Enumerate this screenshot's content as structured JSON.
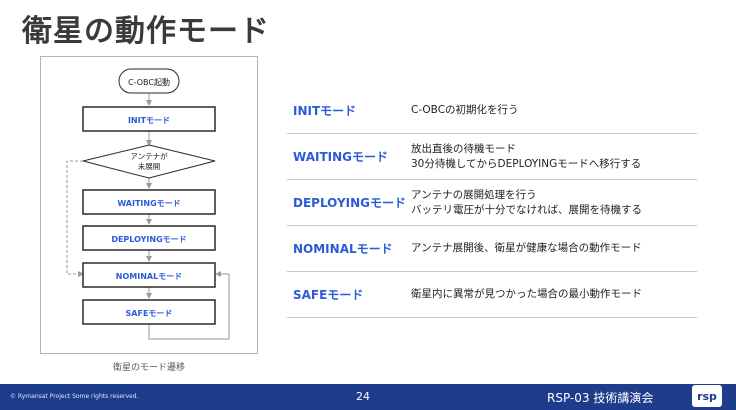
{
  "title": "衛星の動作モード",
  "diagram": {
    "start": "C-OBC起動",
    "init": "INITモード",
    "decision_line1": "アンテナが",
    "decision_line2": "未展開",
    "waiting": "WAITINGモード",
    "deploying": "DEPLOYINGモード",
    "nominal": "NOMINALモード",
    "safe": "SAFEモード",
    "caption": "衛星のモード遷移"
  },
  "table": [
    {
      "mode": "INITモード",
      "desc": [
        "C-OBCの初期化を行う"
      ]
    },
    {
      "mode": "WAITINGモード",
      "desc": [
        "放出直後の待機モード",
        "30分待機してからDEPLOYINGモードへ移行する"
      ]
    },
    {
      "mode": "DEPLOYINGモード",
      "desc": [
        "アンテナの展開処理を行う",
        "バッテリ電圧が十分でなければ、展開を待機する"
      ]
    },
    {
      "mode": "NOMINALモード",
      "desc": [
        "アンテナ展開後、衛星が健康な場合の動作モード"
      ]
    },
    {
      "mode": "SAFEモード",
      "desc": [
        "衛星内に異常が見つかった場合の最小動作モード"
      ]
    }
  ],
  "footer": {
    "copyright": "© Rymansat Project Some rights reserved.",
    "page": "24",
    "event": "RSP-03 技術講演会",
    "logo": "rsp"
  },
  "colors": {
    "accent": "#2b5bd6",
    "footer": "#1e3c8c",
    "box_border": "#2a2a2a",
    "arrow": "#9a9a9a"
  }
}
